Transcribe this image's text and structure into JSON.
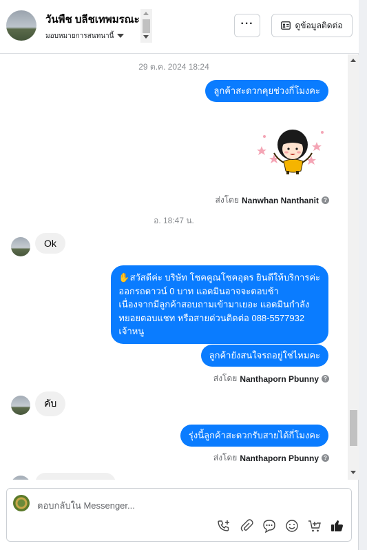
{
  "header": {
    "name": "วันพืช บลีชเทพมรณะ",
    "subtitle": "มอบหมายการสนทนานี้",
    "more_label": "···",
    "contact_label": "ดูข้อมูลติดต่อ"
  },
  "messages": {
    "ts1": "29 ต.ค. 2024 18:24",
    "out1": "ลูกค้าสะดวกคุยช่วงกี่โมงคะ",
    "sent_prefix": "ส่งโดย",
    "sent1_name": "Nanwhan Nanthanit",
    "ts2": "อ. 18:47 น.",
    "in1": "Ok",
    "out2": [
      "✋สวัสดีค่ะ บริษัท โชคคูณโชคอุดร ยินดีให้บริการค่ะ",
      "ออกรถดาวน์ 0 บาท แอดมินอาจจะตอบช้า",
      "เนื่องจากมีลูกค้าสอบถามเข้ามาเยอะ แอดมินกำลัง",
      "ทยอยตอบแชท หรือสายด่วนติดต่อ 088-5577932",
      "เจ้าหนู"
    ],
    "out3": "ลูกค้ายังสนใจรถอยู่ใช่ไหมคะ",
    "sent2_name": "Nanthaporn Pbunny",
    "in2": "คับ",
    "out4": "รุ่งนี้ลูกค้าสะดวกรับสายได้กี่โมงคะ",
    "sent3_name": "Nanthaporn Pbunny"
  },
  "composer": {
    "placeholder": "ตอบกลับใน Messenger..."
  },
  "icons": [
    "more-icon",
    "contact-card-icon",
    "sticker-girl",
    "help-icon",
    "phone-add-icon",
    "attach-icon",
    "saved-reply-icon",
    "emoji-icon",
    "cart-add-icon",
    "thumbs-up-icon"
  ],
  "colors": {
    "outgoing": "#0a7cff",
    "incoming": "#f0f0f0",
    "muted": "#65676b"
  }
}
